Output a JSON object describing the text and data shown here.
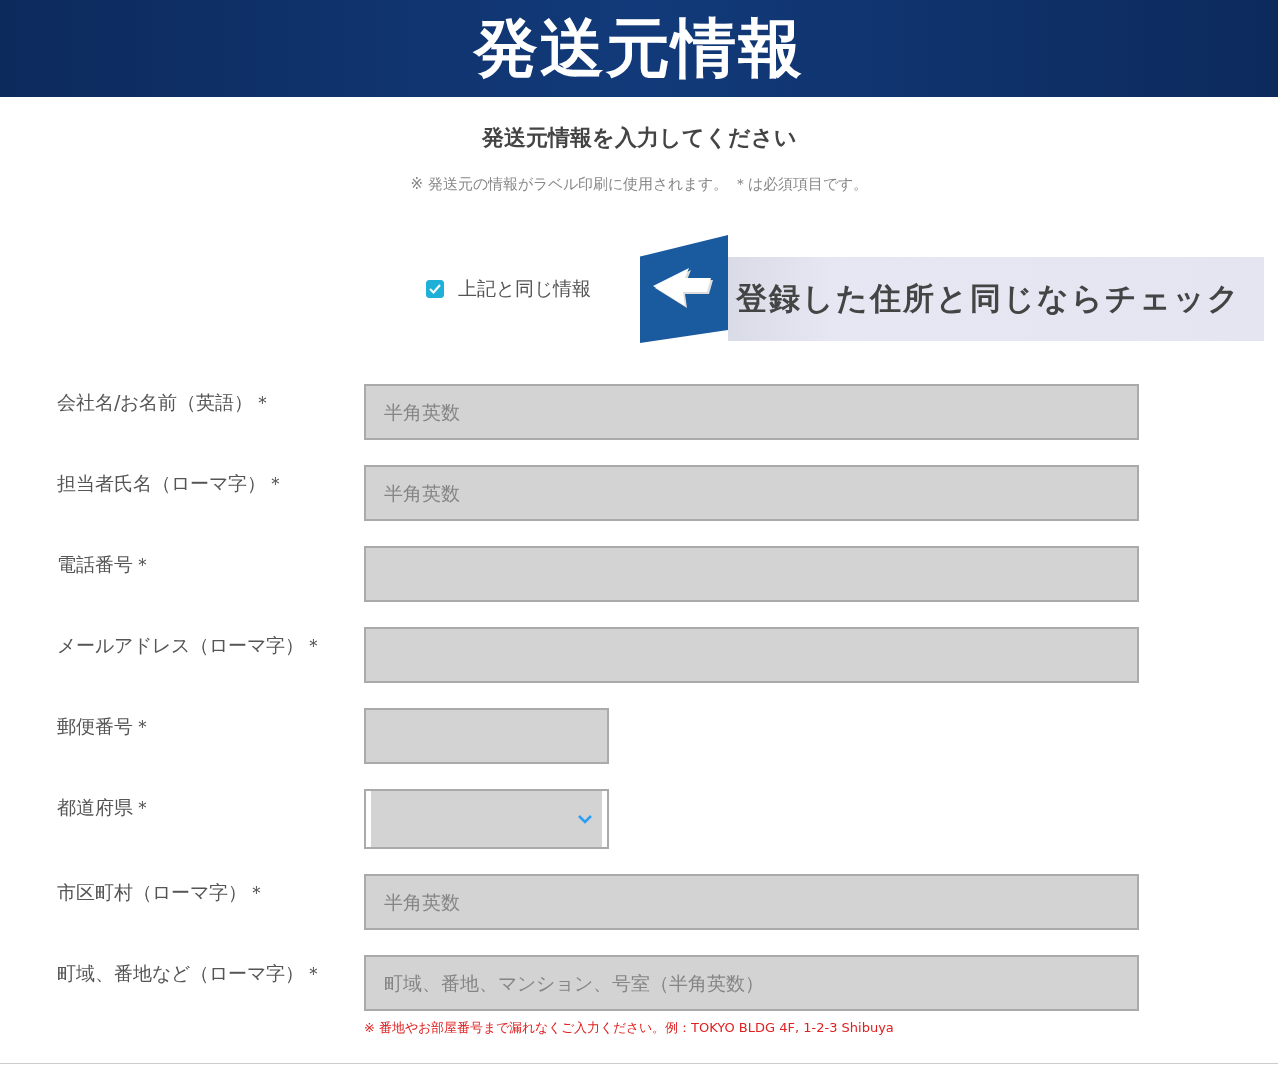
{
  "banner": {
    "title": "発送元情報"
  },
  "heading": "発送元情報を入力してください",
  "note": "※ 発送元の情報がラベル印刷に使用されます。 ＊は必須項目です。",
  "same_info": {
    "label": "上記と同じ情報",
    "checked": true
  },
  "callout": {
    "text": "登録した住所と同じならチェック"
  },
  "fields": [
    {
      "label": "会社名/お名前（英語）＊",
      "kind": "text",
      "placeholder": "半角英数"
    },
    {
      "label": "担当者氏名（ローマ字）＊",
      "kind": "text",
      "placeholder": "半角英数"
    },
    {
      "label": "電話番号＊",
      "kind": "text"
    },
    {
      "label": "メールアドレス（ローマ字）＊",
      "kind": "text"
    },
    {
      "label": "郵便番号＊",
      "kind": "short"
    },
    {
      "label": "都道府県＊",
      "kind": "select"
    },
    {
      "label": "市区町村（ローマ字）＊",
      "kind": "text",
      "placeholder": "半角英数"
    },
    {
      "label": "町域、番地など（ローマ字）＊",
      "kind": "text",
      "placeholder": "町域、番地、マンション、号室（半角英数）",
      "hint": "※ 番地やお部屋番号まで漏れなくご入力ください。例：TOKYO BLDG 4F, 1-2-3 Shibuya"
    }
  ]
}
